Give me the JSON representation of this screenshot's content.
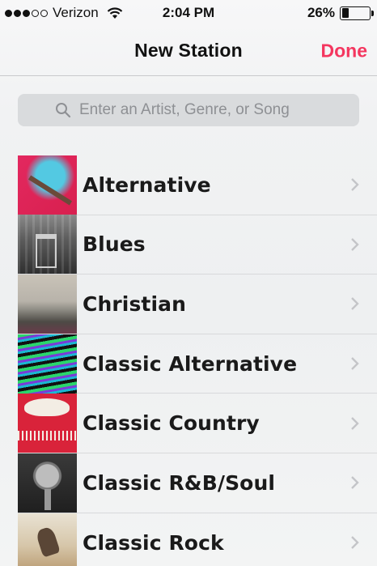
{
  "status_bar": {
    "carrier": "Verizon",
    "time": "2:04 PM",
    "battery_percent": "26%",
    "battery_level": 0.26,
    "signal_bars_filled": 3,
    "signal_bars_total": 5
  },
  "nav": {
    "title": "New Station",
    "done_label": "Done",
    "accent_color": "#f4365f"
  },
  "search": {
    "placeholder": "Enter an Artist, Genre, or Song",
    "value": ""
  },
  "genres": [
    {
      "label": "Alternative",
      "icon": "alternative-artwork"
    },
    {
      "label": "Blues",
      "icon": "blues-artwork"
    },
    {
      "label": "Christian",
      "icon": "christian-artwork"
    },
    {
      "label": "Classic Alternative",
      "icon": "classic-alternative-artwork"
    },
    {
      "label": "Classic Country",
      "icon": "classic-country-artwork"
    },
    {
      "label": "Classic R&B/Soul",
      "icon": "classic-rnb-soul-artwork"
    },
    {
      "label": "Classic Rock",
      "icon": "classic-rock-artwork"
    }
  ]
}
